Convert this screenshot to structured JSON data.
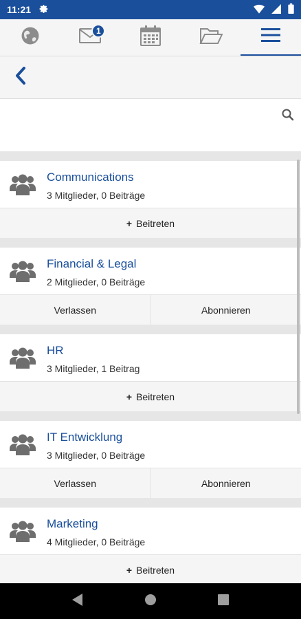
{
  "status_bar": {
    "time": "11:21"
  },
  "tabs": [
    {
      "icon": "globe-icon",
      "badge": ""
    },
    {
      "icon": "mail-icon",
      "badge": "1"
    },
    {
      "icon": "calendar-icon",
      "badge": ""
    },
    {
      "icon": "folder-icon",
      "badge": ""
    },
    {
      "icon": "menu-icon",
      "badge": ""
    }
  ],
  "search": {
    "placeholder": ""
  },
  "groups": [
    {
      "name": "Communications",
      "meta": "3 Mitglieder, 0 Beiträge",
      "join_label": "Beitreten"
    },
    {
      "name": "Financial & Legal",
      "meta": "2 Mitglieder, 0 Beiträge",
      "leave_label": "Verlassen",
      "subscribe_label": "Abonnieren"
    },
    {
      "name": "HR",
      "meta": "3 Mitglieder, 1 Beitrag",
      "join_label": "Beitreten"
    },
    {
      "name": "IT Entwicklung",
      "meta": "3 Mitglieder, 0 Beiträge",
      "leave_label": "Verlassen",
      "subscribe_label": "Abonnieren"
    },
    {
      "name": "Marketing",
      "meta": "4 Mitglieder, 0 Beiträge",
      "join_label": "Beitreten"
    }
  ],
  "colors": {
    "brand": "#1a4f9c",
    "icon_gray": "#6e6e6e"
  }
}
